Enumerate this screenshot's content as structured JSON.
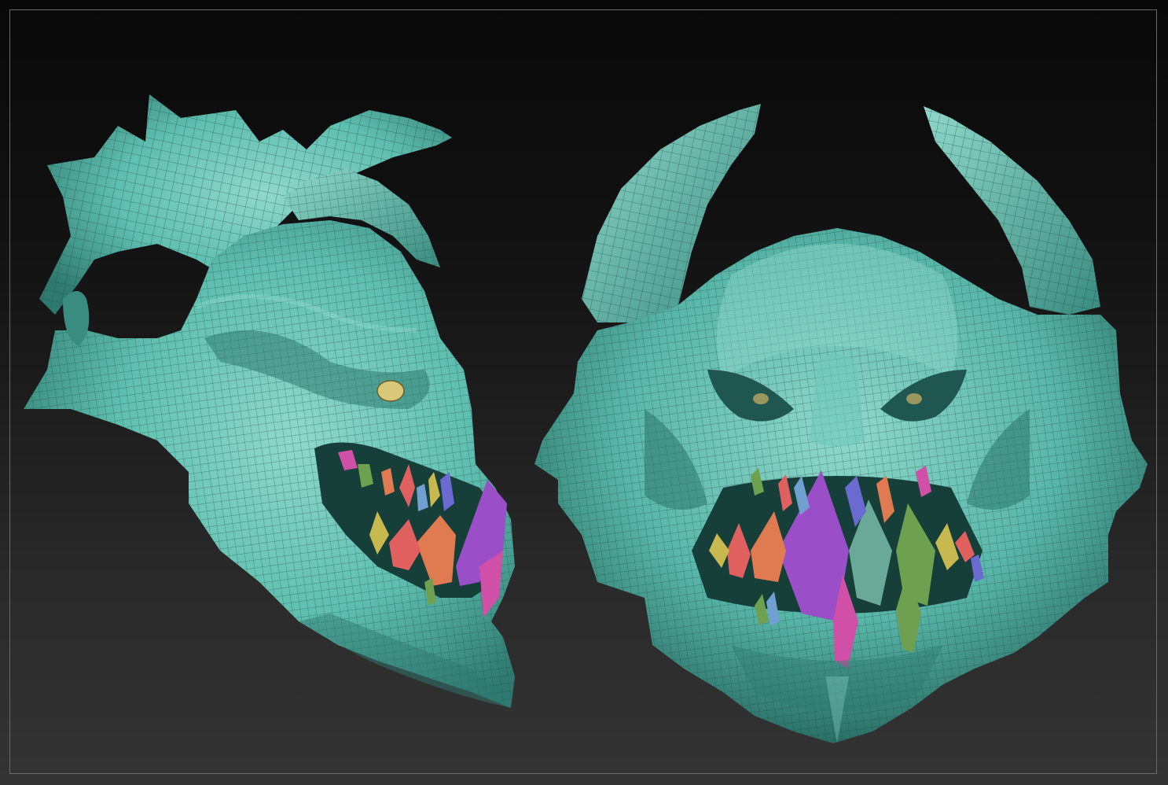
{
  "scene": {
    "subject": "",
    "colors": {
      "background_top": "#080808",
      "background_bottom": "#343434",
      "frame_border": "#6a6a6a",
      "skin": "#5fbfb0",
      "skin_shadow": "#2f7a70",
      "skin_highlight": "#9ae0d4",
      "wire": "#1d4a44",
      "eye": "#d8c878",
      "teeth": [
        "#9a4fc8",
        "#e07a50",
        "#6fa050",
        "#c8b850",
        "#6a6ad0",
        "#d050a8",
        "#e06060",
        "#70a0d0"
      ]
    },
    "views": [
      {
        "id": "side-view"
      },
      {
        "id": "front-view"
      }
    ]
  }
}
